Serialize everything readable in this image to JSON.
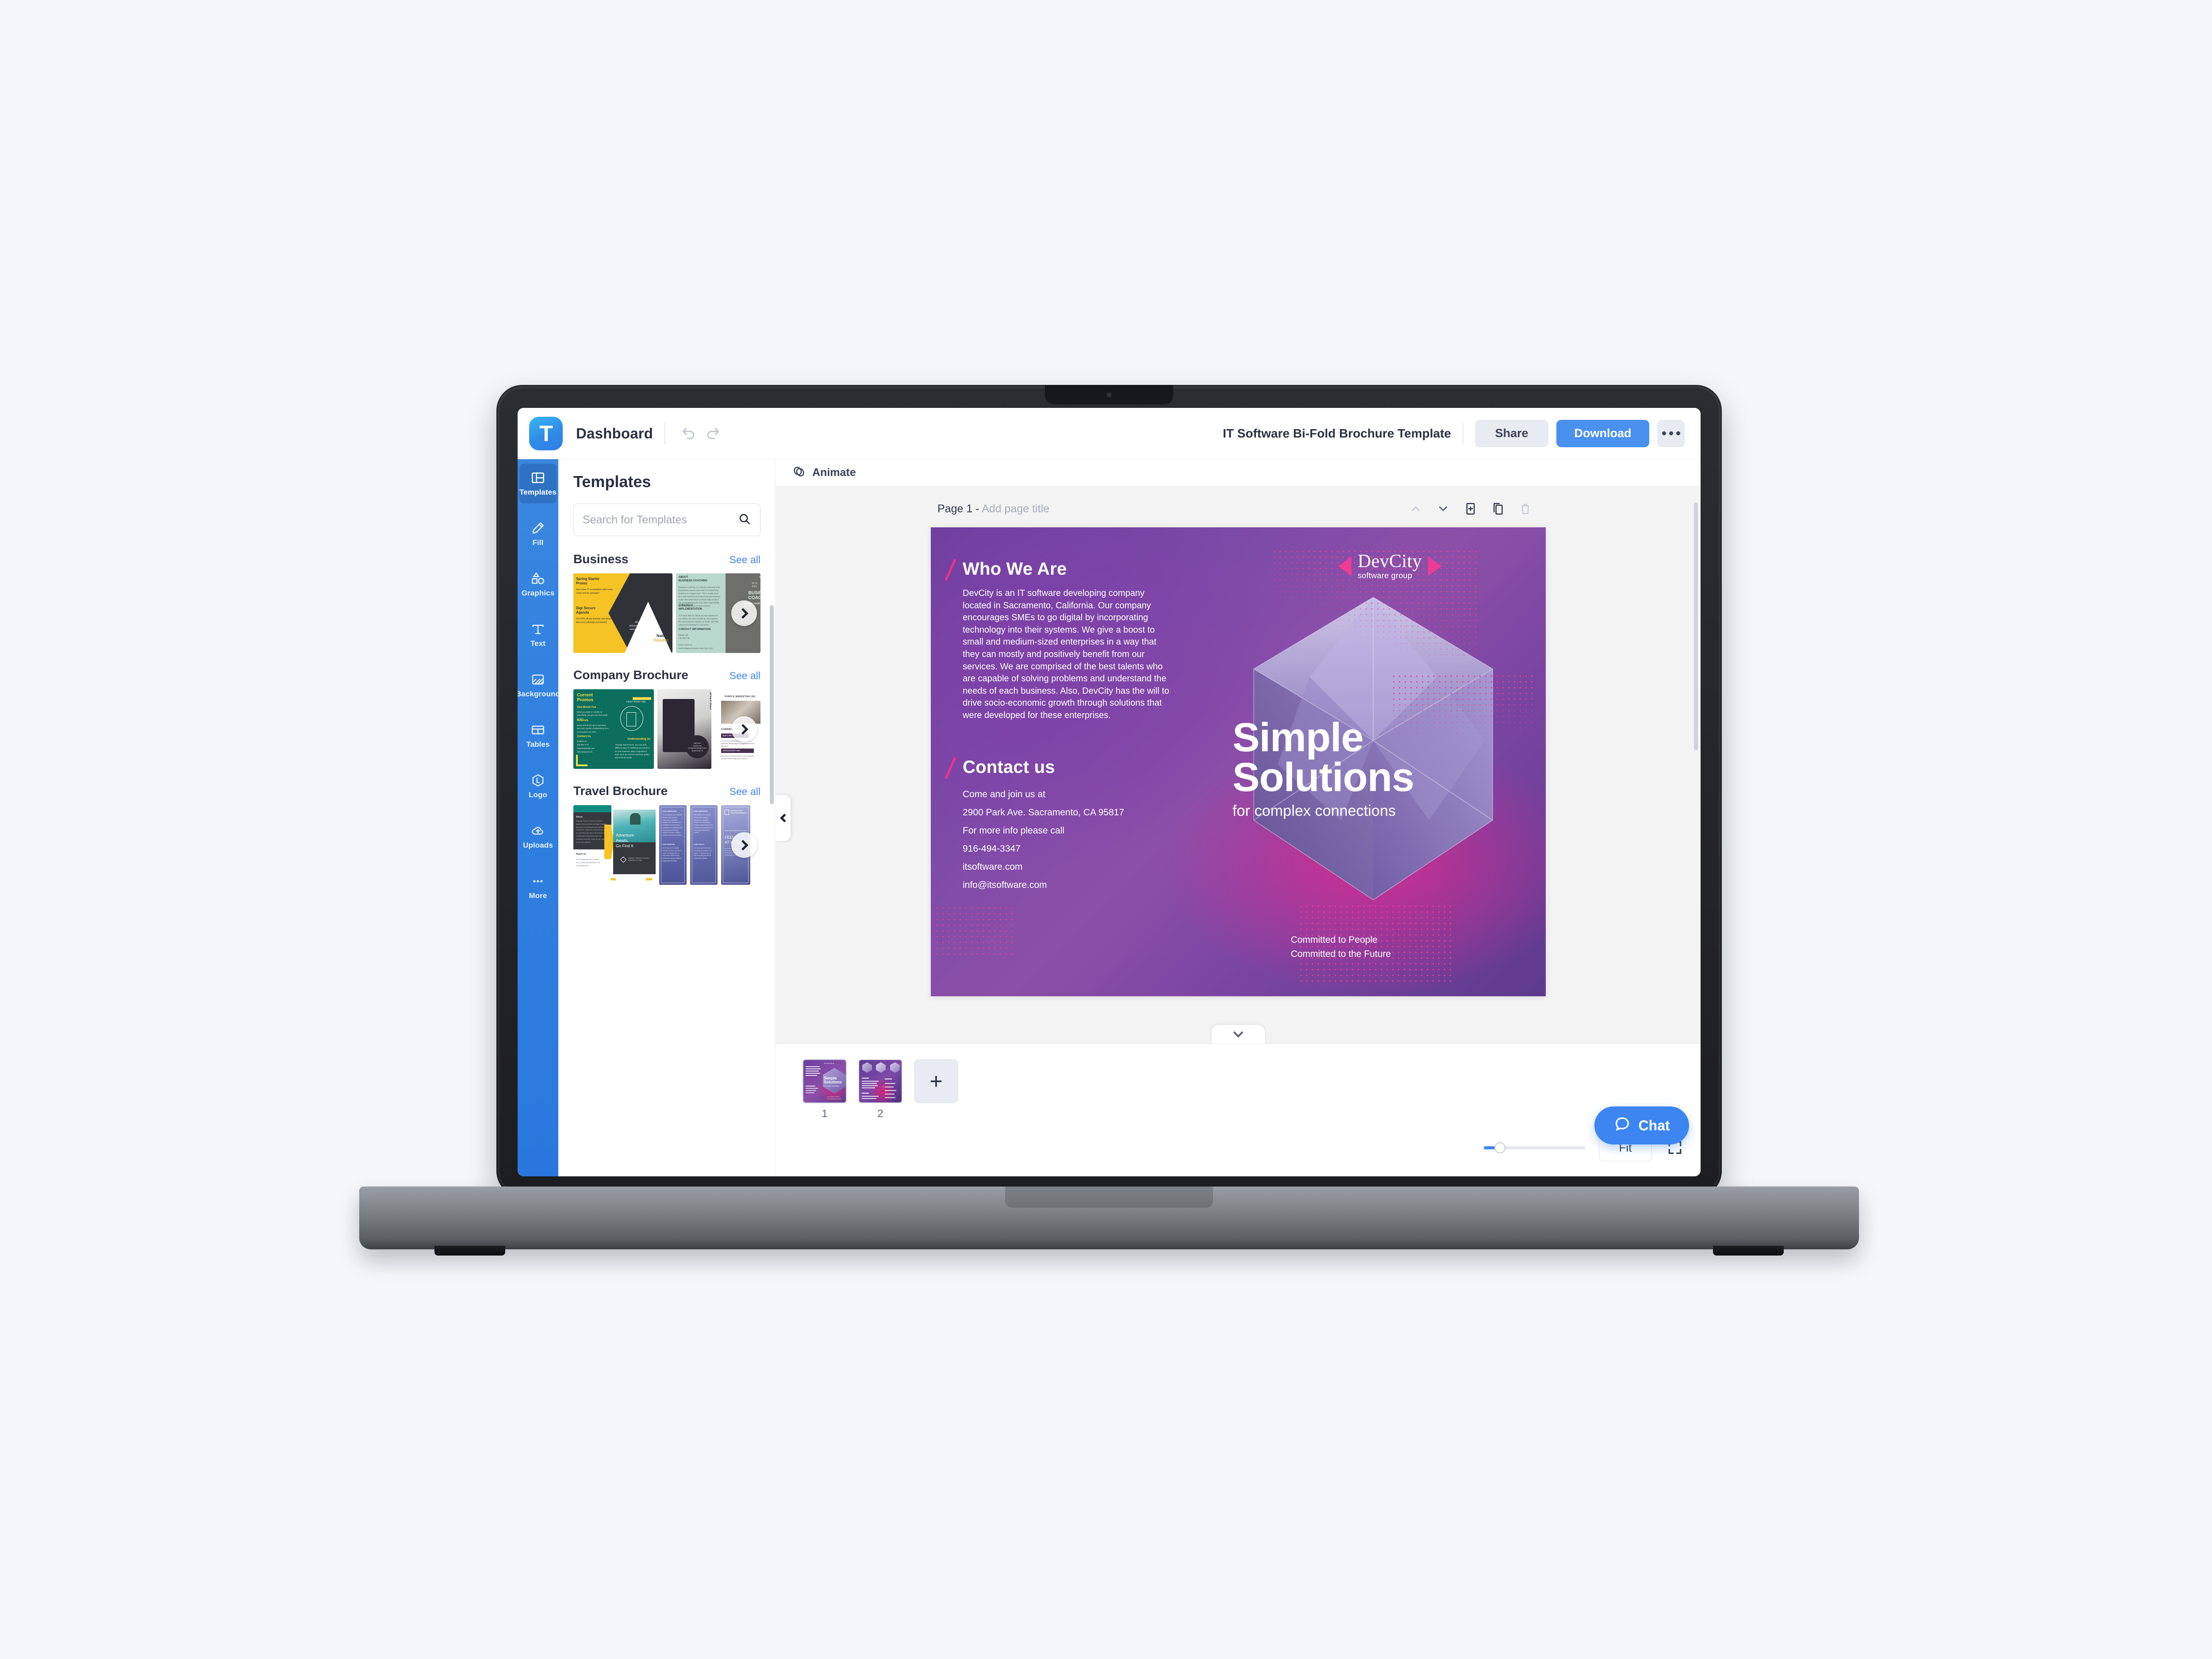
{
  "app": {
    "logo_letter": "T",
    "dashboard_label": "Dashboard",
    "undo_icon": "undo-icon",
    "redo_icon": "redo-icon",
    "document_title": "IT Software Bi-Fold Brochure Template",
    "share_label": "Share",
    "download_label": "Download",
    "more_label": "•••"
  },
  "rail": {
    "items": [
      {
        "label": "Templates",
        "icon": "templates-icon",
        "active": true
      },
      {
        "label": "Fill",
        "icon": "pencil-icon",
        "active": false
      },
      {
        "label": "Graphics",
        "icon": "shapes-icon",
        "active": false
      },
      {
        "label": "Text",
        "icon": "text-icon",
        "active": false
      },
      {
        "label": "Background",
        "icon": "background-icon",
        "active": false
      },
      {
        "label": "Tables",
        "icon": "tables-icon",
        "active": false
      },
      {
        "label": "Logo",
        "icon": "logo-icon",
        "active": false
      },
      {
        "label": "Uploads",
        "icon": "upload-cloud-icon",
        "active": false
      },
      {
        "label": "More",
        "icon": "ellipsis-icon",
        "active": false
      }
    ]
  },
  "panel": {
    "title": "Templates",
    "search": {
      "value": "",
      "placeholder": "Search for Templates"
    },
    "see_all_label": "See all",
    "categories": [
      {
        "name": "Business"
      },
      {
        "name": "Company Brochure"
      },
      {
        "name": "Travel Brochure"
      }
    ]
  },
  "editor": {
    "animate_label": "Animate",
    "page_label": "Page 1 -",
    "page_title_placeholder": "Add page title",
    "toolbar_icons": [
      "move-up-icon",
      "move-down-icon",
      "add-page-icon",
      "duplicate-page-icon",
      "delete-page-icon"
    ]
  },
  "design": {
    "brand_name": "DevCity",
    "brand_sub": "software group",
    "who_heading": "Who We Are",
    "who_body": "DevCity is an IT software developing company located in Sacramento, California. Our company encourages SMEs to go digital by incorporating technology into their systems. We give a boost to small and medium-sized enterprises in a way that they can mostly and positively benefit from our services. We are comprised of the best talents who are capable of solving problems and understand the needs of each business. Also, DevCity has the will to drive socio-economic growth through solutions that were developed for these enterprises.",
    "contact_heading": "Contact us",
    "contact_lines": [
      "Come and join us at",
      "2900 Park Ave. Sacramento, CA 95817",
      "For more info please call",
      "916-494-3347",
      "itsoftware.com",
      "info@itsoftware.com"
    ],
    "hero_line1": "Simple",
    "hero_line2": "Solutions",
    "hero_sub": "for complex connections",
    "commit_line1": "Committed to People",
    "commit_line2": "Committed to the Future",
    "colors": {
      "purple": "#6b3f9e",
      "magenta": "#ec268f",
      "pink_dots": "#ef3b96"
    }
  },
  "bottom": {
    "pages": [
      {
        "number": "1",
        "selected": true
      },
      {
        "number": "2",
        "selected": false
      }
    ],
    "add_page_label": "+",
    "zoom_fit_label": "Fit",
    "zoom_value": 12,
    "chat_label": "Chat"
  },
  "templates_art": {
    "business": [
      {
        "t1": "Spring Starter",
        "t2": "Promo",
        "b1": "Get a free IT consultation with every cloud service package!",
        "t3": "Digi Secure",
        "t4": "Agenda",
        "b2": "Get 25% off any backup and disaster discovery package purchased!",
        "phone": "333 666 7777",
        "mail": "nationrepublic@gmail.net",
        "site": "www.nationrepublic.com",
        "brand1": "Nation",
        "brand2": "Republic"
      },
      {
        "h1": "ABOUT",
        "h2": "BUSINESS COACHING",
        "h3": "STRATEGY",
        "h4": "IMPLEMENTATION",
        "h5": "CONTACT INFORMATION",
        "title1": "BUSINESS",
        "title2": "COACHING",
        "tag": "MAKING YOUR BUSINESS GROW",
        "date": "09 13 2019"
      }
    ],
    "company": [
      {
        "t1": "Current",
        "t2": "Promos",
        "s1": "One Month Fee",
        "s2": "Referrals",
        "s3": "Contact Us",
        "s4": "Understanding Us",
        "brand": "FAST POST INC."
      },
      {
        "label": "PURPLE MARKETING",
        "h1": "CURRENT PROMOS",
        "b1": "BUY 2 GET 1",
        "b2": "AFFILIATION'S LINK"
      }
    ],
    "travel": [
      {
        "t1": "Adventure",
        "t2": "Awaits,",
        "t3": "Go Find It",
        "h1": "About",
        "h2": "Reach Us"
      },
      {
        "h1": "OUR AMENITIES",
        "h2": "OUR MISSION",
        "h3": "OUR GOALS",
        "t1": "FEEL",
        "t2": "AT HOME",
        "brand": "SUN BAY COVE"
      }
    ]
  }
}
